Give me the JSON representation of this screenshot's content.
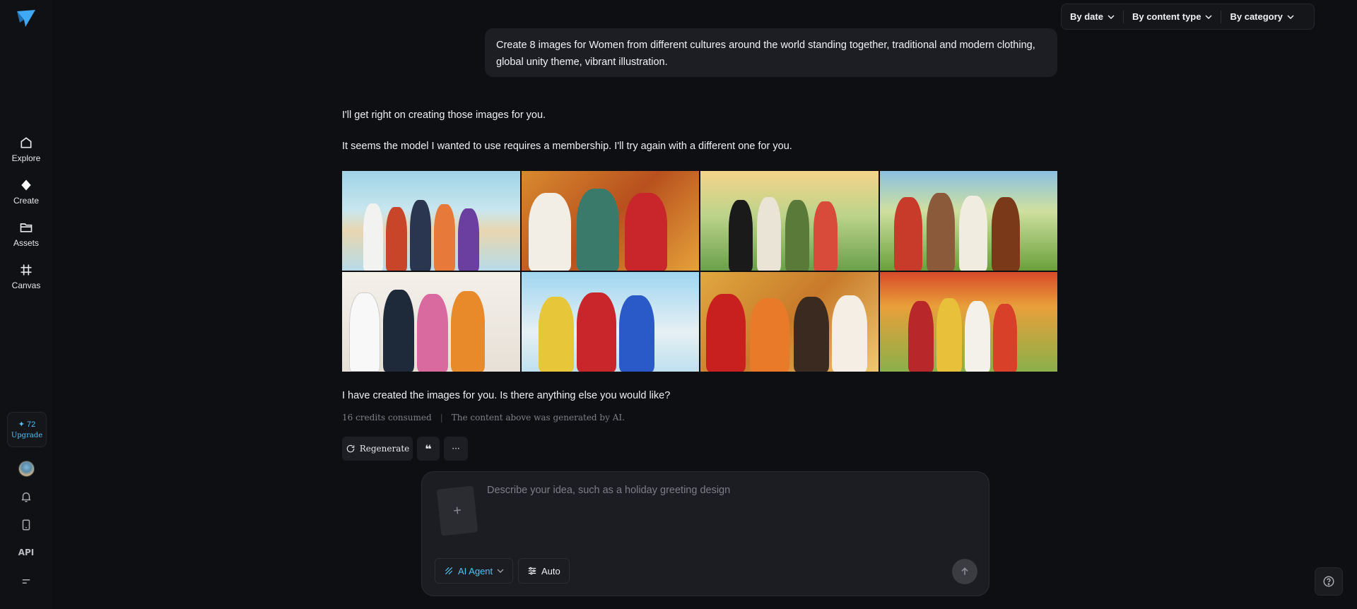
{
  "sidebar": {
    "nav": [
      {
        "label": "Explore",
        "icon": "home-icon"
      },
      {
        "label": "Create",
        "icon": "diamond-icon"
      },
      {
        "label": "Assets",
        "icon": "folder-icon"
      },
      {
        "label": "Canvas",
        "icon": "canvas-icon"
      }
    ],
    "credits": {
      "amount": "✦ 72",
      "upgrade_label": "Upgrade"
    },
    "api_label": "API"
  },
  "filters": [
    {
      "label": "By date"
    },
    {
      "label": "By content type"
    },
    {
      "label": "By category"
    }
  ],
  "chat": {
    "user_message": "Create 8 images for Women from different cultures around the world standing together, traditional and modern clothing, global unity theme, vibrant illustration.",
    "assistant_line_1": "I'll get right on creating those images for you.",
    "assistant_line_2": "It seems the model I wanted to use requires a membership. I'll try again with a different one for you.",
    "assistant_line_3": "I have created the images for you. Is there anything else you would like?",
    "credits_consumed": "16 credits consumed",
    "ai_notice": "The content above was generated by AI.",
    "regenerate_label": "Regenerate"
  },
  "composer": {
    "placeholder": "Describe your idea, such as a holiday greeting design",
    "agent_label": "AI Agent",
    "auto_label": "Auto"
  },
  "colors": {
    "accent": "#4fc3f7",
    "background": "#0e0f12",
    "panel": "#1b1d22"
  }
}
